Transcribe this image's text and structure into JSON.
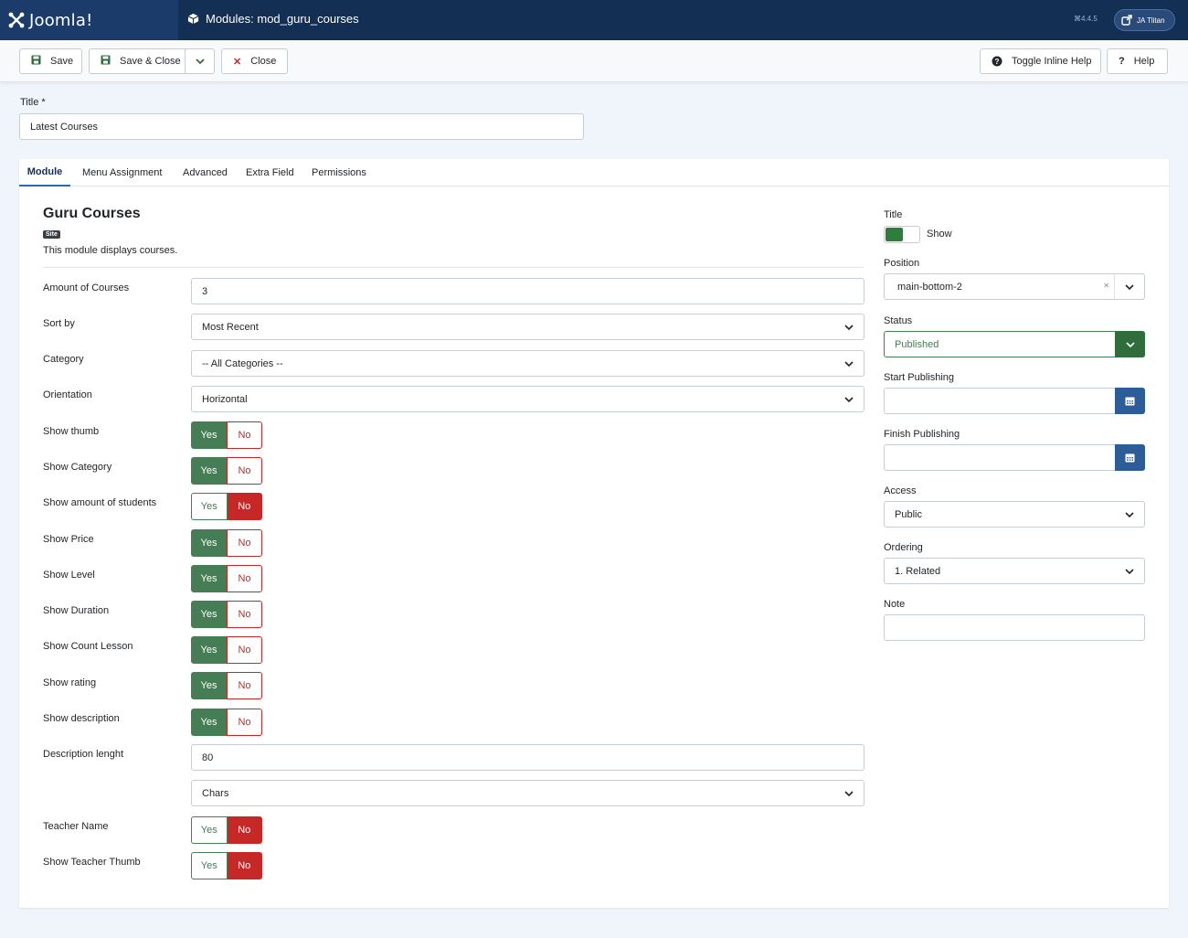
{
  "header": {
    "logo_text": "Joomla!",
    "page_title": "Modules: mod_guru_courses",
    "version": "⌘4.4.5",
    "user": "JA Tlitan"
  },
  "toolbar": {
    "save": "Save",
    "save_close": "Save & Close",
    "close": "Close",
    "toggle_help": "Toggle Inline Help",
    "help": "Help"
  },
  "title_field": {
    "label": "Title *",
    "value": "Latest Courses"
  },
  "tabs": [
    "Module",
    "Menu Assignment",
    "Advanced",
    "Extra Field",
    "Permissions"
  ],
  "module": {
    "name": "Guru Courses",
    "badge": "Site",
    "description": "This module displays courses."
  },
  "fields": {
    "amount": {
      "label": "Amount of Courses",
      "value": "3"
    },
    "sort": {
      "label": "Sort by",
      "value": "Most Recent"
    },
    "category": {
      "label": "Category",
      "value": "-- All Categories --"
    },
    "orientation": {
      "label": "Orientation",
      "value": "Horizontal"
    },
    "desc_length": {
      "label": "Description lenght",
      "value": "80",
      "unit": "Chars"
    }
  },
  "yes_label": "Yes",
  "no_label": "No",
  "toggles": [
    {
      "label": "Show thumb",
      "value": "yes"
    },
    {
      "label": "Show Category",
      "value": "yes"
    },
    {
      "label": "Show amount of students",
      "value": "no"
    },
    {
      "label": "Show Price",
      "value": "yes"
    },
    {
      "label": "Show Level",
      "value": "yes"
    },
    {
      "label": "Show Duration",
      "value": "yes"
    },
    {
      "label": "Show Count Lesson",
      "value": "yes"
    },
    {
      "label": "Show rating",
      "value": "yes"
    },
    {
      "label": "Show description",
      "value": "yes"
    },
    {
      "label": "Teacher Name",
      "value": "no"
    },
    {
      "label": "Show Teacher Thumb",
      "value": "no"
    }
  ],
  "sidebar": {
    "title_label": "Title",
    "title_toggle": "Show",
    "position_label": "Position",
    "position_value": "main-bottom-2",
    "status_label": "Status",
    "status_value": "Published",
    "start_label": "Start Publishing",
    "start_value": "",
    "finish_label": "Finish Publishing",
    "finish_value": "",
    "access_label": "Access",
    "access_value": "Public",
    "ordering_label": "Ordering",
    "ordering_value": "1. Related",
    "note_label": "Note",
    "note_value": ""
  },
  "colors": {
    "header": "#132f53",
    "success": "#457d54",
    "danger": "#c52827",
    "primary": "#2d5d98"
  }
}
